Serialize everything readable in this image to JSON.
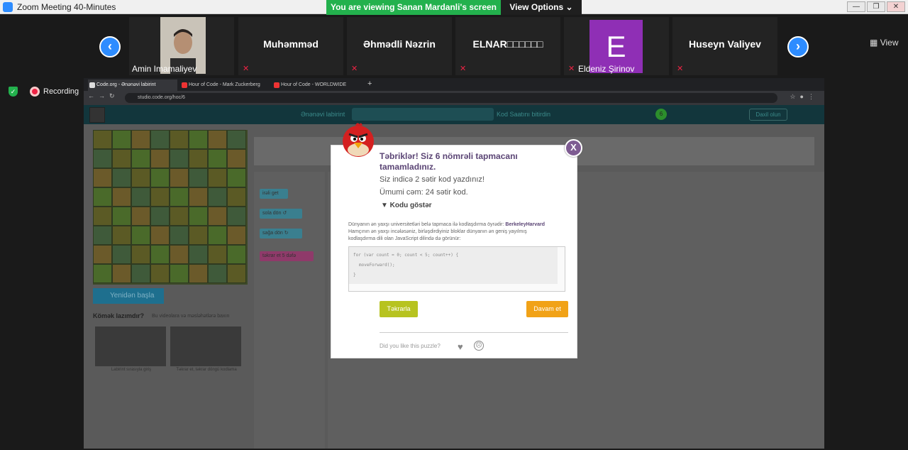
{
  "window": {
    "title": "Zoom Meeting 40-Minutes",
    "controls": [
      "—",
      "❐",
      "✕"
    ]
  },
  "share_banner": "You are viewing Sanan Mardanli's screen",
  "view_options": "View Options",
  "view_button": "View",
  "gallery": {
    "participants": [
      {
        "kind": "video",
        "label": "Amin Imamaliyev"
      },
      {
        "kind": "name",
        "name": "Muhəmməd"
      },
      {
        "kind": "name",
        "name": "Əhmədli Nəzrin"
      },
      {
        "kind": "name",
        "name": "ELNAR□□□□□□"
      },
      {
        "kind": "avatar",
        "initial": "E",
        "label": "Eldeniz Şirinov"
      },
      {
        "kind": "name",
        "name": "Huseyn Valiyev"
      }
    ],
    "prev": "‹",
    "next": "›"
  },
  "recording": "Recording",
  "browser": {
    "tabs": [
      "Code.org - Ənənəvi labirint",
      "Hour of Code - Mark Zuckerberg",
      "Hour of Code - WORLDWIDE"
    ],
    "new_tab": "+",
    "url": "studio.code.org/hoc/6"
  },
  "codeorg": {
    "level_label": "Ənənəvi labirint",
    "level_number": "6",
    "hour_label": "Kod Saatını bitirdin",
    "signin": "Daxil olun",
    "reset": "Yenidən başla",
    "help_title": "Kömək lazımdır?",
    "help_sub": "Bu videolara və məsləhətlərə baxın",
    "videos": [
      "Labirint sırasıyla giriş",
      "Təkrar et, təkrar döngü kodlama"
    ],
    "blocks": [
      "irəli get",
      "sola dön ↺",
      "sağa dön ↻",
      "təkrar et 5 dəfə"
    ]
  },
  "dialog": {
    "title": "Təbriklər! Siz 6 nömrəli tapmacanı tamamladınız.",
    "line1": "Siz indicə 2 sətir kod yazdınız!",
    "line2": "Ümumi cəm: 24 sətir kod.",
    "show_code": "▼ Kodu göstər",
    "para_a": "Dünyanın ən yaxşı universitetləri belə tapmaca ilə kodlaşdırma öyrədir:",
    "para_b": "BerkeleyHarvard",
    "para_c": "Hamçının ən yaxşı incələsəniz, birləşdirdiyiniz bloklar dünyanın ən geniş yayılmış kodlaşdırma dili olan JavaScript dilində də görünür:",
    "code": [
      "for (var count = 0; count < 5; count++) {",
      "  moveForward();",
      "}"
    ],
    "again": "Təkrarla",
    "continue": "Davam et",
    "like_prompt": "Did you like this puzzle?",
    "close": "X"
  }
}
